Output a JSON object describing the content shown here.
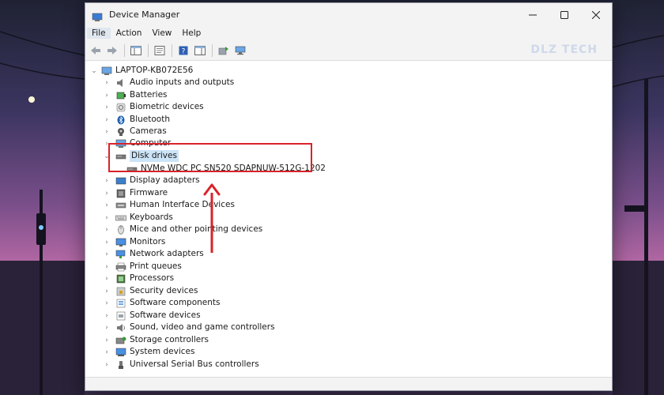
{
  "window": {
    "title": "Device Manager"
  },
  "menu": [
    {
      "label": "File"
    },
    {
      "label": "Action"
    },
    {
      "label": "View"
    },
    {
      "label": "Help"
    }
  ],
  "watermark": "DLZ TECH",
  "tree": {
    "root": "LAPTOP-KB072E56",
    "items": [
      {
        "label": "Audio inputs and outputs",
        "icon": "speaker-icon"
      },
      {
        "label": "Batteries",
        "icon": "battery-icon"
      },
      {
        "label": "Biometric devices",
        "icon": "fingerprint-icon"
      },
      {
        "label": "Bluetooth",
        "icon": "bluetooth-icon"
      },
      {
        "label": "Cameras",
        "icon": "camera-icon"
      },
      {
        "label": "Computer",
        "icon": "computer-icon"
      },
      {
        "label": "Disk drives",
        "icon": "disk-drive-icon",
        "expanded": true,
        "selected": true
      },
      {
        "label": "NVMe WDC PC SN520 SDAPNUW-512G-1202",
        "icon": "disk-drive-icon",
        "child": true
      },
      {
        "label": "Display adapters",
        "icon": "display-adapter-icon"
      },
      {
        "label": "Firmware",
        "icon": "firmware-icon"
      },
      {
        "label": "Human Interface Devices",
        "icon": "hid-icon"
      },
      {
        "label": "Keyboards",
        "icon": "keyboard-icon"
      },
      {
        "label": "Mice and other pointing devices",
        "icon": "mouse-icon"
      },
      {
        "label": "Monitors",
        "icon": "monitor-icon"
      },
      {
        "label": "Network adapters",
        "icon": "network-icon"
      },
      {
        "label": "Print queues",
        "icon": "printer-icon"
      },
      {
        "label": "Processors",
        "icon": "processor-icon"
      },
      {
        "label": "Security devices",
        "icon": "security-icon"
      },
      {
        "label": "Software components",
        "icon": "software-component-icon"
      },
      {
        "label": "Software devices",
        "icon": "software-device-icon"
      },
      {
        "label": "Sound, video and game controllers",
        "icon": "sound-icon"
      },
      {
        "label": "Storage controllers",
        "icon": "storage-icon"
      },
      {
        "label": "System devices",
        "icon": "system-icon"
      },
      {
        "label": "Universal Serial Bus controllers",
        "icon": "usb-icon"
      }
    ]
  },
  "colors": {
    "highlight": "#d9232a",
    "selection": "#cce4f7"
  }
}
